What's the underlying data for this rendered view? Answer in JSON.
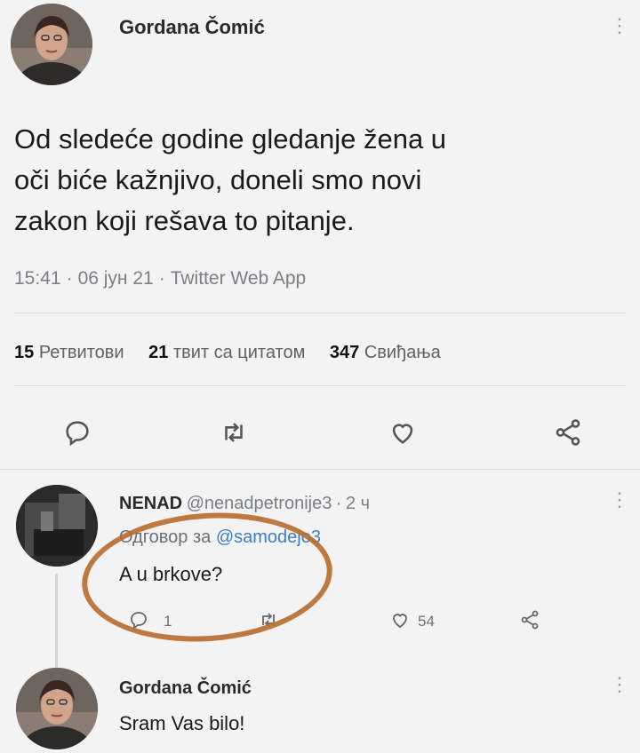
{
  "tweet": {
    "author": "Gordana Čomić",
    "text_lines": [
      "Od sledeće godine gledanje žena u",
      "oči biće kažnjivo, doneli smo novi",
      "zakon koji rešava to pitanje."
    ],
    "time": "15:41",
    "date": "06 јун 21",
    "source": "Twitter Web App",
    "stats": {
      "retweets_count": "15",
      "retweets_label": "Ретвитови",
      "quotes_count": "21",
      "quotes_label": "твит са цитатом",
      "likes_count": "347",
      "likes_label": "Свиђања"
    },
    "actions": [
      "reply-icon",
      "retweet-icon",
      "heart-icon",
      "share-icon"
    ]
  },
  "reply": {
    "name": "NENAD",
    "handle": "@nenadpetronije3",
    "age": "2 ч",
    "reply_to_label": "Одговор за",
    "reply_to_handle": "@samodejo3",
    "text": "A u brkove?",
    "reply_count": "1",
    "like_count": "54"
  },
  "response": {
    "name": "Gordana Čomić",
    "text": "Sram Vas bilo!"
  },
  "colors": {
    "link": "#3f7cc2",
    "annotation": "#b76b2c",
    "muted": "#7a7f86"
  }
}
